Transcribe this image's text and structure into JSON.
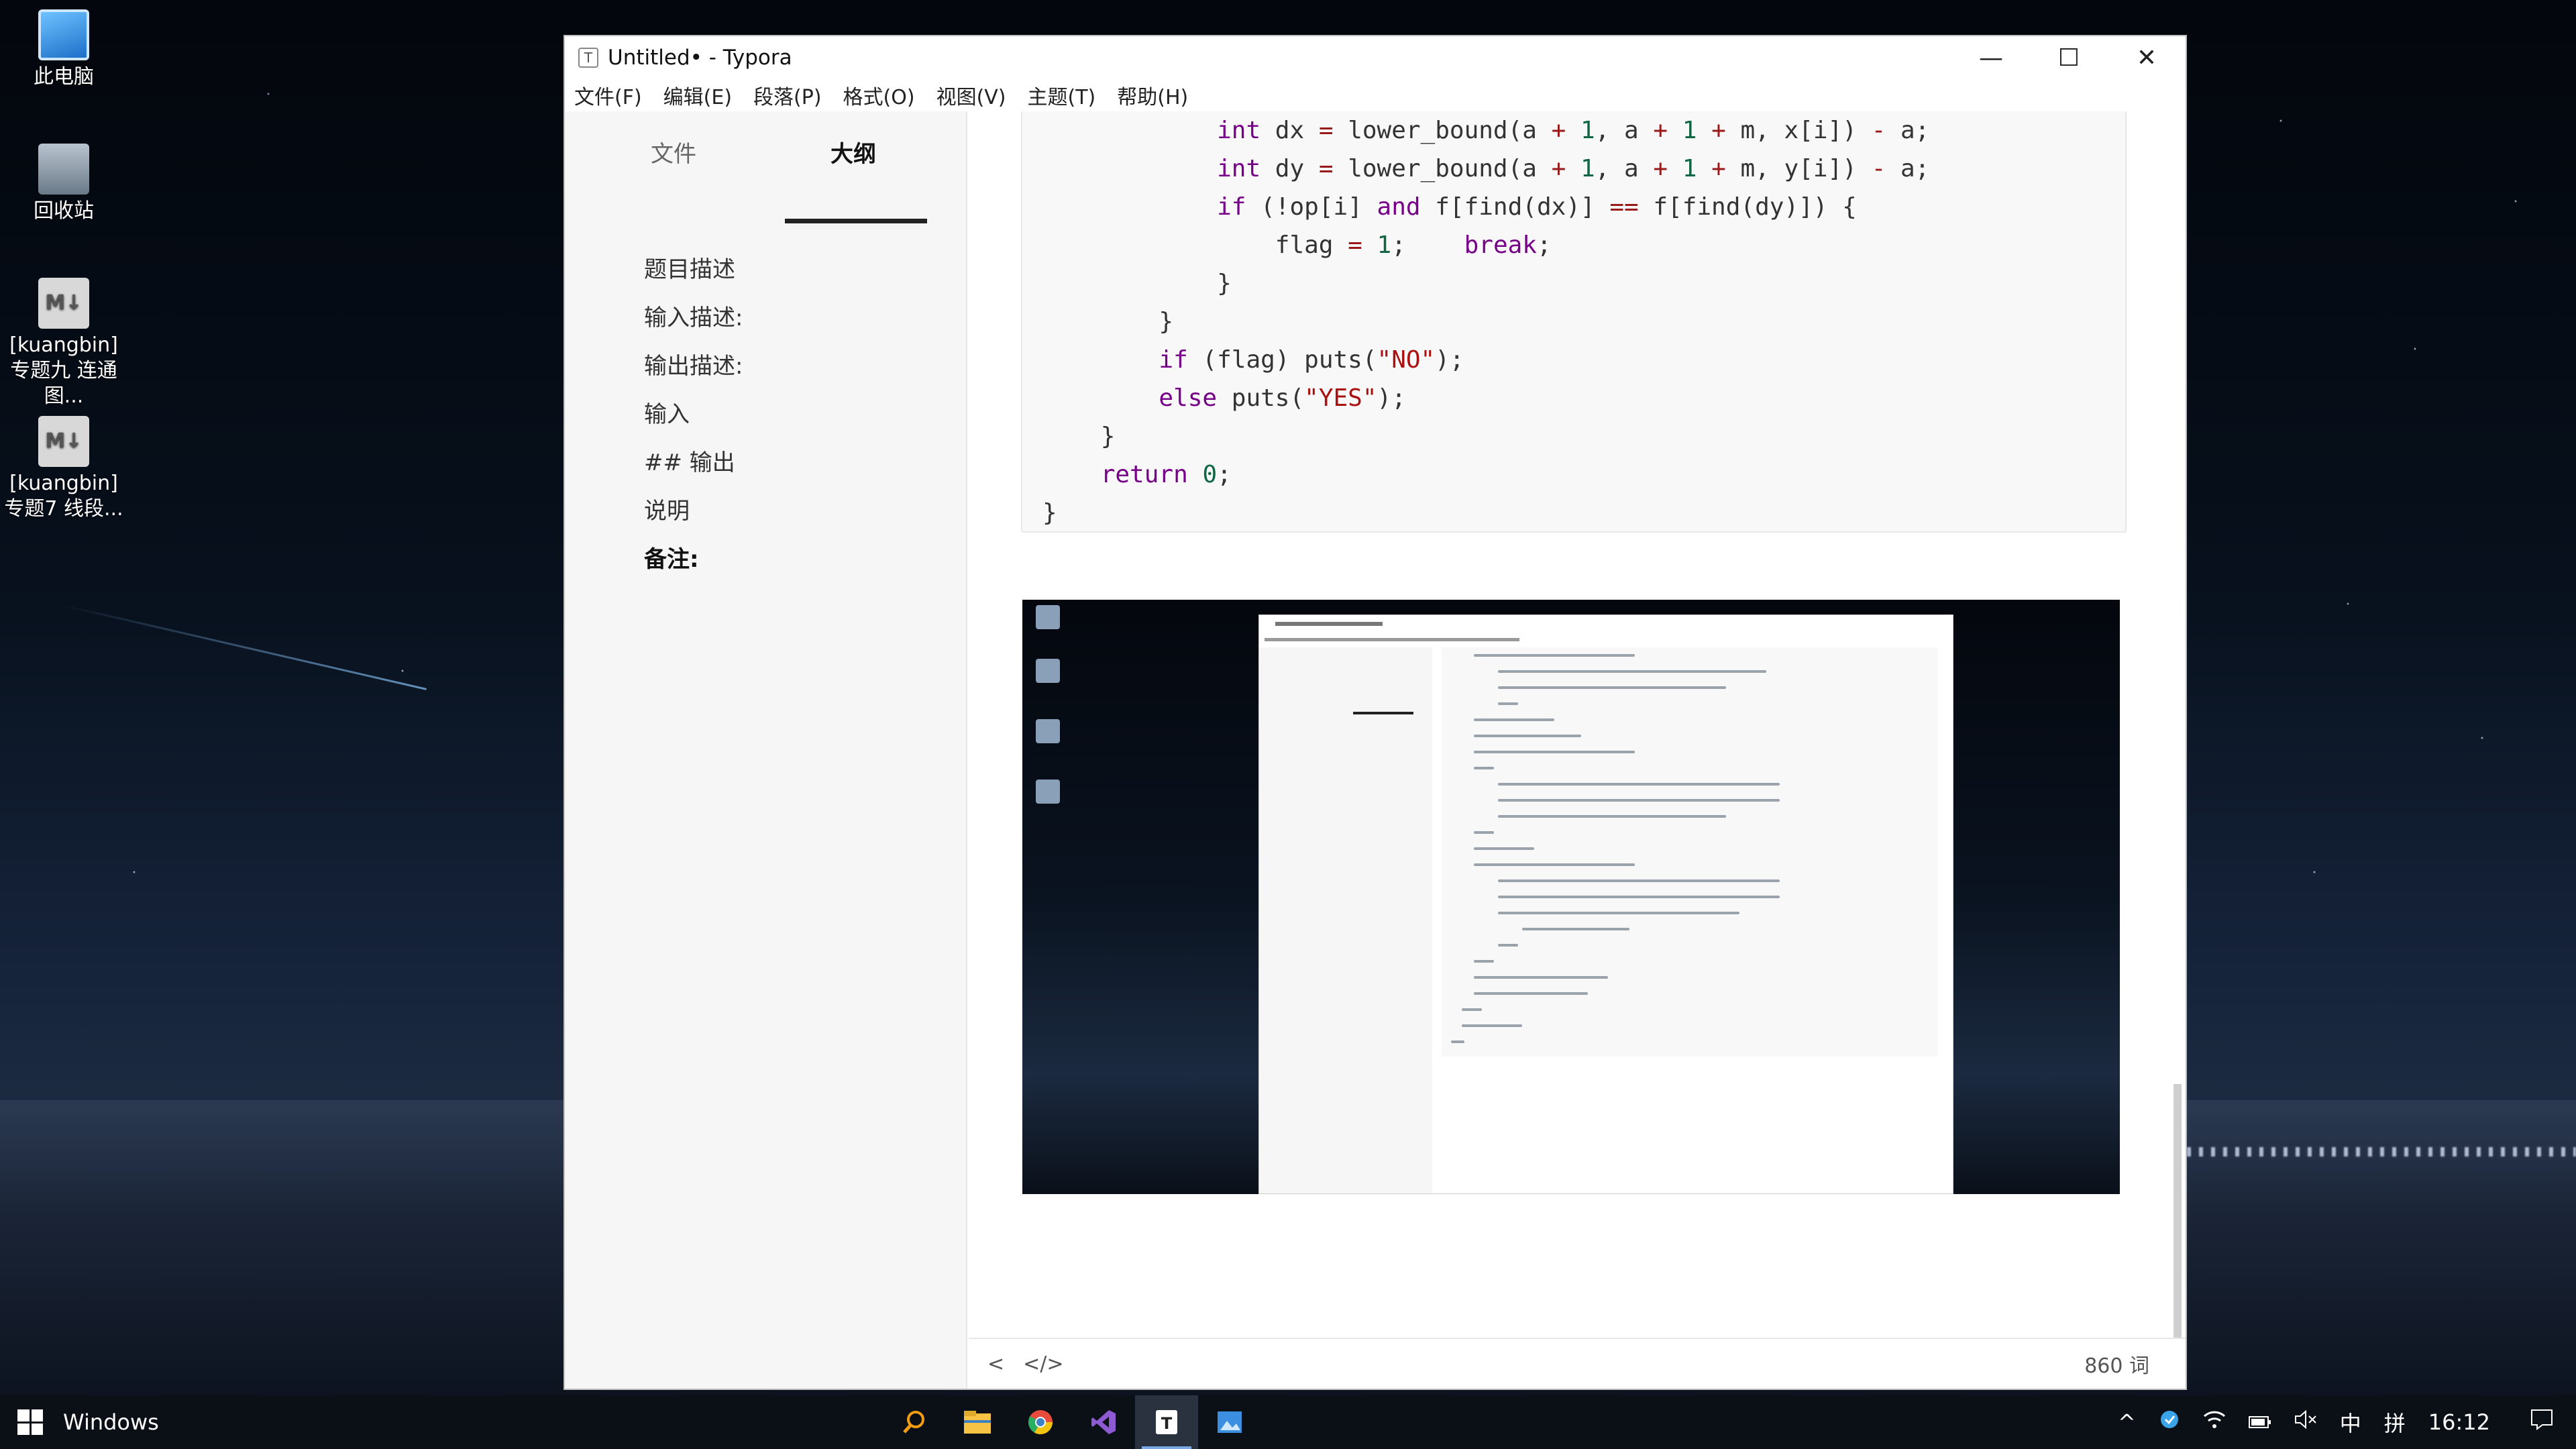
{
  "desktop": {
    "icons": [
      {
        "label": "此电脑"
      },
      {
        "label": "回收站"
      },
      {
        "label": "[kuangbin]专题九 连通图..."
      },
      {
        "label": "[kuangbin] 专题7 线段..."
      }
    ]
  },
  "window": {
    "app_icon": "T",
    "title": "Untitled• - Typora",
    "controls": {
      "minimize": "—",
      "maximize": "☐",
      "close": "✕"
    }
  },
  "menu": {
    "items": [
      "文件(F)",
      "编辑(E)",
      "段落(P)",
      "格式(O)",
      "视图(V)",
      "主题(T)",
      "帮助(H)"
    ]
  },
  "sidebar": {
    "tabs": {
      "files": "文件",
      "outline": "大纲"
    },
    "outline": [
      "题目描述",
      "输入描述:",
      "输出描述:",
      "输入",
      "## 输出",
      "说明",
      "备注:"
    ]
  },
  "code": {
    "lines": [
      "            int dx = lower_bound(a + 1, a + 1 + m, x[i]) - a;",
      "            int dy = lower_bound(a + 1, a + 1 + m, y[i]) - a;",
      "            if (!op[i] and f[find(dx)] == f[find(dy)]) {",
      "                flag = 1;    break;",
      "            }",
      "        }",
      "        if (flag) puts(\"NO\");",
      "        else puts(\"YES\");",
      "    }",
      "    return 0;",
      "}"
    ]
  },
  "status": {
    "back": "<",
    "source": "</>",
    "word_count": "860 词"
  },
  "taskbar": {
    "search_label": "Windows",
    "apps": [
      "search-icon",
      "file-explorer-icon",
      "chrome-icon",
      "visual-studio-icon",
      "typora-icon",
      "photo-app-icon"
    ],
    "tray": {
      "chevron": "^",
      "ime": "中",
      "layout": "拼",
      "time": "16:12"
    }
  },
  "colors": {
    "keyword": "#770088",
    "number": "#116644",
    "string": "#aa1111",
    "accent": "#7aa8e6"
  }
}
